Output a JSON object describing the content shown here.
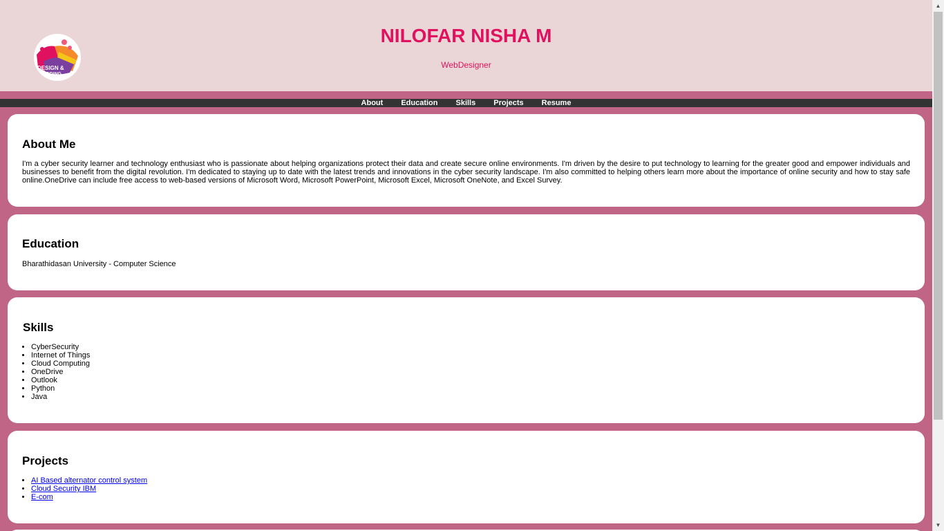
{
  "header": {
    "name": "NILOFAR NISHA M",
    "role": "WebDesigner",
    "logo_text_1": "DESIGN &",
    "logo_text_2": "CODING"
  },
  "nav": {
    "items": [
      "About",
      "Education",
      "Skills",
      "Projects",
      "Resume"
    ]
  },
  "about": {
    "title": "About Me",
    "text": "I'm a cyber security learner and technology enthusiast who is passionate about helping organizations protect their data and create secure online environments. I'm driven by the desire to put technology to learning for the greater good and empower individuals and businesses to benefit from the digital revolution. I'm dedicated to staying up to date with the latest trends and innovations in the cyber security landscape. I'm also committed to helping others learn more about the importance of online security and how to stay safe online.OneDrive can include free access to web-based versions of Microsoft Word, Microsoft PowerPoint, Microsoft Excel, Microsoft OneNote, and Excel Survey."
  },
  "education": {
    "title": "Education",
    "text": "Bharathidasan University - Computer Science"
  },
  "skills": {
    "title": "Skills",
    "items": [
      "CyberSecurity",
      "Internet of Things",
      "Cloud Computing",
      "OneDrive",
      "Outlook",
      "Python",
      "Java"
    ]
  },
  "projects": {
    "title": "Projects",
    "items": [
      "AI Based alternator control system",
      "Cloud Security IBM",
      "E-com"
    ]
  },
  "colors": {
    "accent": "#e0115f",
    "header_bg": "#ead6d6",
    "page_bg": "#c06585",
    "nav_bg": "#333333"
  },
  "icons": {
    "scroll_up": "▲",
    "scroll_down": "▼"
  }
}
